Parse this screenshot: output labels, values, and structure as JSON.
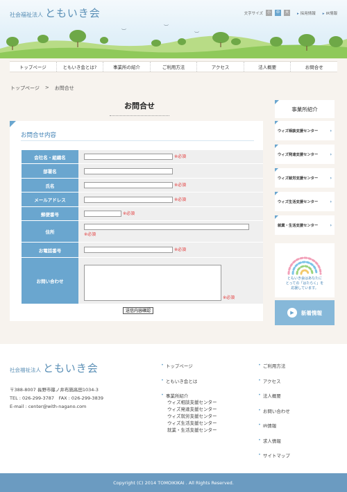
{
  "header": {
    "logo_sub": "社会福祉法人",
    "logo_main": "ともいき会",
    "font_size_label": "文字サイズ",
    "font_sizes": [
      "小",
      "中",
      "大"
    ],
    "links": [
      "採用情報",
      "IR情報"
    ]
  },
  "nav": [
    "トップページ",
    "ともいき会とは?",
    "事業所の紹介",
    "ご利用方法",
    "アクセス",
    "法人概要",
    "お問合せ"
  ],
  "breadcrumb": {
    "home": "トップページ",
    "sep": ">",
    "current": "お問合せ"
  },
  "page_title": "お問合せ",
  "form": {
    "heading": "お問合せ内容",
    "required": "※必須",
    "fields": {
      "company": "会社名・組織名",
      "department": "部署名",
      "name": "氏名",
      "email": "メールアドレス",
      "postal": "郵便番号",
      "address": "住所",
      "phone": "お電話番号",
      "inquiry": "お問い合わせ"
    },
    "submit": "送信内容確認"
  },
  "sidebar": {
    "title": "事業所紹介",
    "items": [
      "ウィズ相談支援センター",
      "ウィズ発達支援センター",
      "ウィズ就労支援センター",
      "ウィズ生活支援センター",
      "就業・生活支援センター"
    ],
    "banner_text": [
      "ともいき会はあなたに",
      "とっての「はたらく」を",
      "応援しています。"
    ],
    "news_button": "新着情報"
  },
  "footer": {
    "logo_sub": "社会福祉法人",
    "logo_main": "ともいき会",
    "address": "〒388-8007 長野市篠ノ井布施高田1034-3",
    "tel_fax": "TEL : 026-299-3787　FAX : 026-299-3839",
    "email": "E-mail : center@with-nagano.com",
    "col1": [
      "トップページ",
      "ともいき会とは",
      "事業所紹介"
    ],
    "col1_sub": [
      "ウィズ相談支援センター",
      "ウィズ発達支援センター",
      "ウィズ就労支援センター",
      "ウィズ生活支援センター",
      "就業・生活支援センター"
    ],
    "col2": [
      "ご利用方法",
      "アクセス",
      "法人概要",
      "お問い合わせ",
      "IR情報",
      "求人情報",
      "サイトマップ"
    ],
    "copyright": "Copyright (C) 2014 TOMOIKIKAI . All Rights Reserved."
  },
  "colors": {
    "accent": "#6aa6cf",
    "required": "#e23b3b",
    "footer_bar": "#6b9bc1"
  }
}
